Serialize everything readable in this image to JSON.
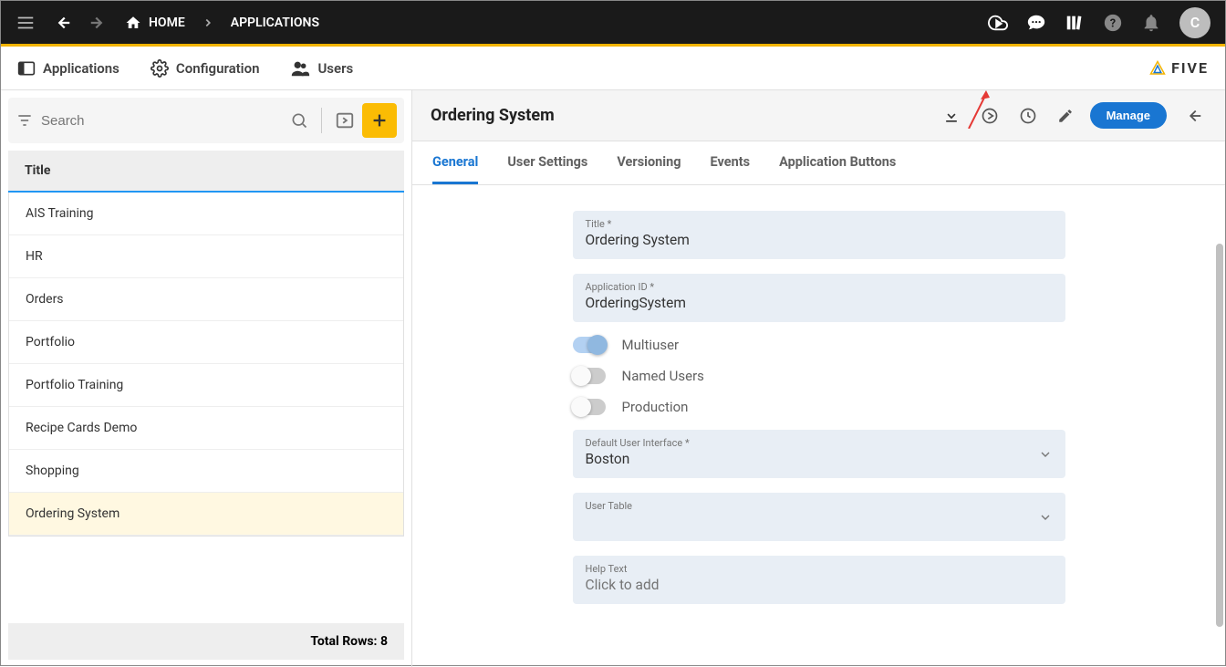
{
  "topbar": {
    "home_label": "HOME",
    "current_crumb": "APPLICATIONS",
    "avatar_initial": "C"
  },
  "seconbar": {
    "tabs": [
      {
        "label": "Applications"
      },
      {
        "label": "Configuration"
      },
      {
        "label": "Users"
      }
    ],
    "brand": "FIVE"
  },
  "leftpane": {
    "search_placeholder": "Search",
    "list_header": "Title",
    "items": [
      "AIS Training",
      "HR",
      "Orders",
      "Portfolio",
      "Portfolio Training",
      "Recipe Cards Demo",
      "Shopping",
      "Ordering System"
    ],
    "selected_index": 7,
    "footer": "Total Rows: 8"
  },
  "detail": {
    "title": "Ordering System",
    "manage_label": "Manage",
    "tabs": [
      "General",
      "User Settings",
      "Versioning",
      "Events",
      "Application Buttons"
    ],
    "active_tab": 0,
    "fields": {
      "title_label": "Title *",
      "title_value": "Ordering System",
      "appid_label": "Application ID *",
      "appid_value": "OrderingSystem",
      "multiuser_label": "Multiuser",
      "multiuser_on": true,
      "namedusers_label": "Named Users",
      "namedusers_on": false,
      "production_label": "Production",
      "production_on": false,
      "defaultui_label": "Default User Interface *",
      "defaultui_value": "Boston",
      "usertable_label": "User Table",
      "usertable_value": "",
      "helptext_label": "Help Text",
      "helptext_placeholder": "Click to add"
    }
  }
}
